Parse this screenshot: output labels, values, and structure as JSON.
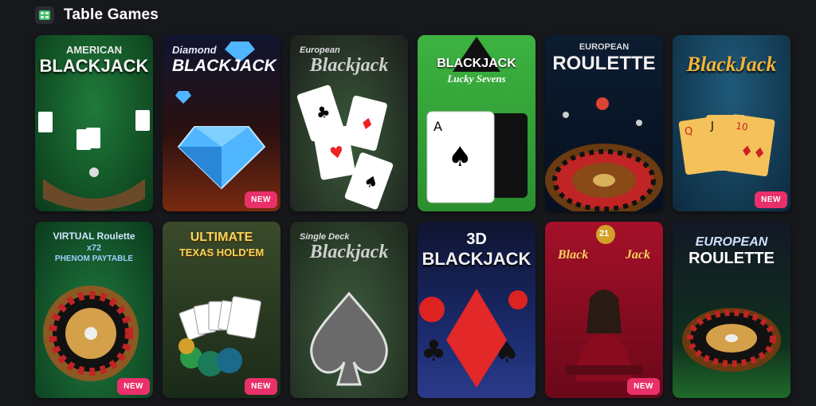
{
  "section": {
    "title": "Table Games",
    "icon": "table-games-icon"
  },
  "badge_label": "NEW",
  "games": [
    {
      "id": "american-blackjack",
      "line1": "AMERICAN",
      "line2": "BLACKJACK",
      "new": false
    },
    {
      "id": "diamond-blackjack",
      "line1": "Diamond",
      "line2": "BLACKJACK",
      "new": true
    },
    {
      "id": "european-blackjack",
      "line1": "European",
      "line2": "Blackjack",
      "new": false
    },
    {
      "id": "blackjack-lucky-sevens",
      "line1": "BLACKJACK",
      "line2": "Lucky Sevens",
      "new": false
    },
    {
      "id": "european-roulette-1",
      "line1": "EUROPEAN",
      "line2": "ROULETTE",
      "new": false
    },
    {
      "id": "blackjack-classic",
      "line1": "BlackJack",
      "line2": "",
      "new": true
    },
    {
      "id": "virtual-roulette",
      "line1": "VIRTUAL Roulette",
      "line2": "x72",
      "line3": "PHENOM PAYTABLE",
      "new": true
    },
    {
      "id": "ultimate-texas-holdem",
      "line1": "ULTIMATE",
      "line2": "TEXAS HOLD'EM",
      "new": true
    },
    {
      "id": "single-deck-blackjack",
      "line1": "Single Deck",
      "line2": "Blackjack",
      "new": false
    },
    {
      "id": "3d-blackjack",
      "line1": "3D",
      "line2": "BLACKJACK",
      "new": false
    },
    {
      "id": "black-jack-21",
      "line1": "Black",
      "line2": "Jack",
      "line3": "21",
      "new": true
    },
    {
      "id": "european-roulette-2",
      "line1": "EUROPEAN",
      "line2": "ROULETTE",
      "new": false
    }
  ],
  "colors": {
    "background": "#17181c",
    "badge": "#e8306b"
  }
}
